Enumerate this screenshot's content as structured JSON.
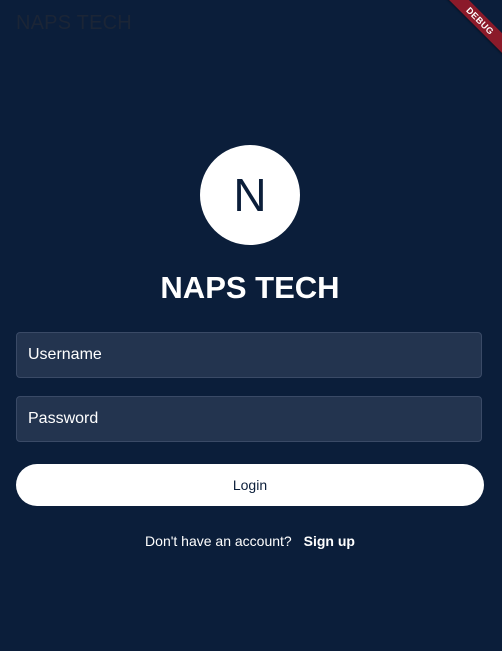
{
  "appbar": {
    "title": "NAPS TECH"
  },
  "debug_banner": {
    "label": "DEBUG"
  },
  "avatar": {
    "letter": "N"
  },
  "brand": {
    "title": "NAPS TECH"
  },
  "form": {
    "username_placeholder": "Username",
    "password_placeholder": "Password",
    "login_label": "Login"
  },
  "signup": {
    "prompt": "Don't have an account?",
    "link_label": "Sign up"
  },
  "colors": {
    "background": "#0b1e3a",
    "field_fill": "#23344f",
    "debug_banner": "#8b1a2a",
    "button": "#ffffff"
  }
}
